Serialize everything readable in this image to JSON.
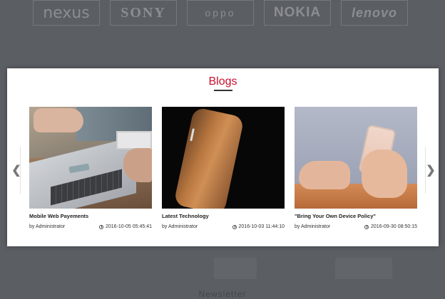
{
  "background": {
    "brands": [
      "nexus",
      "SONY",
      "oppo",
      "NOKIA",
      "lenovo"
    ],
    "section_heading": "Newsletter"
  },
  "modal": {
    "title": "Blogs",
    "accent_color": "#c8102e",
    "prev_icon": "chevron-left-icon",
    "next_icon": "chevron-right-icon",
    "prev_glyph": "❮",
    "next_glyph": "❯",
    "posts": [
      {
        "title": "Mobile Web Payements",
        "author": "by Administrator",
        "date": "2016-10-05 05:45:41",
        "image": "laptop and phone on wooden table"
      },
      {
        "title": "Latest Technology",
        "author": "by Administrator",
        "date": "2016-10-03 11:44:10",
        "image": "leather phone case"
      },
      {
        "title": "\"Bring Your Own Device Policy\"",
        "author": "by Administrator",
        "date": "2016-09-30 08:50:15",
        "image": "hands holding smartphone"
      }
    ]
  }
}
